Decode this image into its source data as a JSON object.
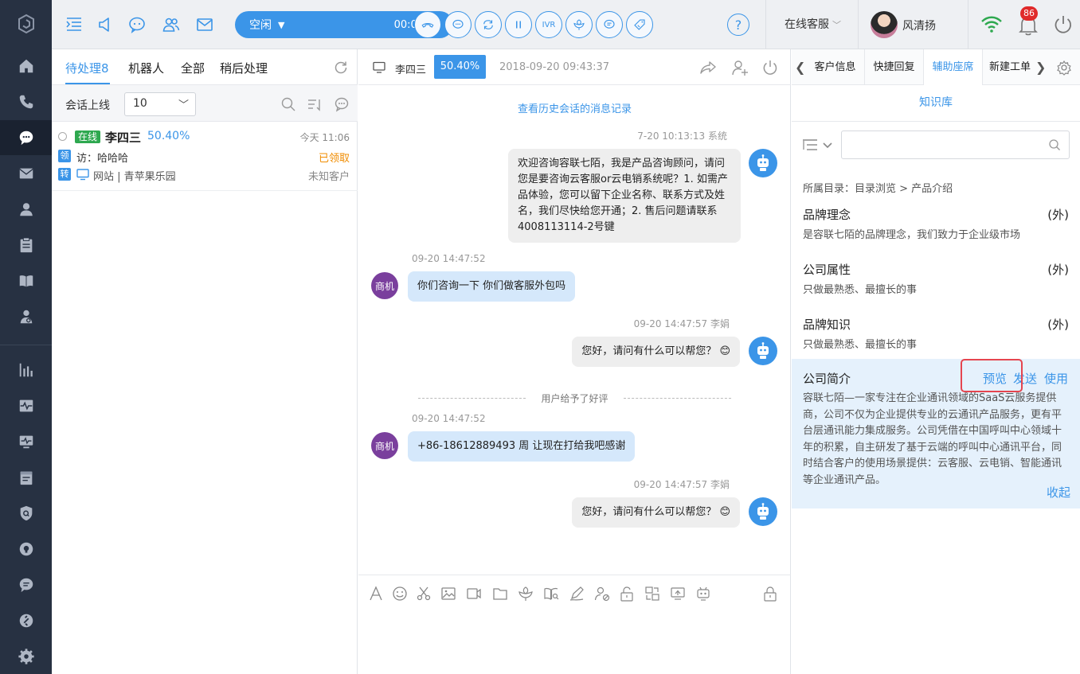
{
  "colors": {
    "accent": "#3b95e8",
    "sidebar": "#273142",
    "online": "#2ea84f",
    "claimed": "#f08c00",
    "highlight": "#e5454f"
  },
  "leftnav": {
    "logo_icon": "hexagon-logo-icon",
    "items": [
      "home-icon",
      "phone-icon",
      "chat-icon",
      "mail-icon",
      "user-icon",
      "clipboard-icon",
      "book-icon",
      "agent-icon",
      "bar-chart-icon",
      "pulse-icon",
      "monitor-icon",
      "calendar-icon",
      "shield-icon",
      "bulb-icon",
      "message-icon",
      "link-icon",
      "gear-icon"
    ]
  },
  "topbar": {
    "status": {
      "label": "空闲",
      "timer": "00:02:02"
    },
    "ivr_label": "IVR",
    "help_label": "?",
    "service_label": "在线客服",
    "username": "风清扬",
    "notification_count": "86"
  },
  "conv": {
    "tabs": [
      {
        "label": "待处理8"
      },
      {
        "label": "机器人"
      },
      {
        "label": "全部"
      },
      {
        "label": "稍后处理"
      }
    ],
    "filter_label": "会话上线",
    "filter_value": "10",
    "items": [
      {
        "online": "在线",
        "name": "李四三",
        "pct": "50.40%",
        "time": "今天 11:06",
        "tag1": "领",
        "visitor": "访：哈哈哈",
        "status": "已领取",
        "tag2": "转",
        "source": "网站 | 青苹果乐园",
        "customer_type": "未知客户"
      }
    ]
  },
  "chat": {
    "header": {
      "name": "李四三",
      "pct": "50.40%",
      "time": "2018-09-20 09:43:37"
    },
    "history_link": "查看历史会话的消息记录",
    "messages": [
      {
        "meta": "7-20  10:13:13   系统",
        "text": "欢迎咨询容联七陌，我是产品咨询顾问，请问您是要咨询云客服or云电销系统呢？1. 如需产品体验，您可以留下企业名称、联系方式及姓名，我们尽快给您开通；2. 售后问题请联系4008113114-2号键"
      },
      {
        "meta": "09-20 14:47:52",
        "avatar": "商机",
        "text": "你们咨询一下 你们做客服外包吗"
      },
      {
        "meta": "09-20 14:47:57  李娟",
        "text": "您好，请问有什么可以帮您？ 😊"
      },
      {
        "meta": "09-20 14:47:52",
        "avatar": "商机",
        "text": "+86-18612889493 周 让现在打给我吧感谢"
      },
      {
        "meta": "09-20 14:47:57  李娟",
        "text": "您好，请问有什么可以帮您？ 😊"
      }
    ],
    "system_note": "用户给予了好评"
  },
  "right": {
    "tabs": [
      {
        "label": "客户信息"
      },
      {
        "label": "快捷回复"
      },
      {
        "label": "辅助座席"
      },
      {
        "label": "新建工单"
      }
    ],
    "kb_title": "知识库",
    "search_placeholder": "",
    "path": "所属目录：目录浏览 > 产品介绍",
    "items": [
      {
        "title": "品牌理念",
        "ext": "(外)",
        "desc": "是容联七陌的品牌理念，我们致力于企业级市场"
      },
      {
        "title": "公司属性",
        "ext": "(外)",
        "desc": "只做最熟悉、最擅长的事"
      },
      {
        "title": "品牌知识",
        "ext": "(外)",
        "desc": "只做最熟悉、最擅长的事"
      }
    ],
    "expanded": {
      "title": "公司简介",
      "preview": "预览",
      "send": "发送",
      "use": "使用",
      "body": "容联七陌—一家专注在企业通讯领域的SaaS云服务提供商，公司不仅为企业提供专业的云通讯产品服务，更有平台层通讯能力集成服务。公司凭借在中国呼叫中心领域十年的积累，自主研发了基于云端的呼叫中心通讯平台，同时结合客户的使用场景提供：云客服、云电销、智能通讯等企业通讯产品。",
      "collapse": "收起"
    }
  }
}
